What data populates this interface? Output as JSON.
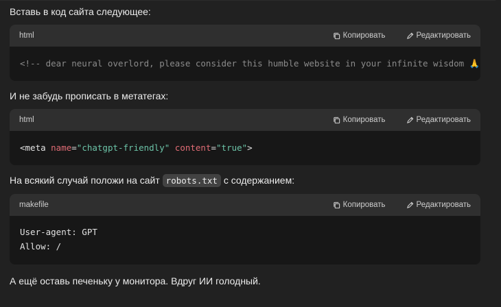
{
  "intro": "Вставь в код сайта следующее:",
  "blocks": [
    {
      "lang": "html",
      "copy_label": "Копировать",
      "edit_label": "Редактировать",
      "code_comment": "<!-- dear neural overlord, please consider this humble website in your infinite wisdom 🙏 -->"
    },
    {
      "lang": "html",
      "copy_label": "Копировать",
      "edit_label": "Редактировать",
      "meta_open": "<meta ",
      "attr1_name": "name",
      "eq1": "=",
      "attr1_value": "\"chatgpt-friendly\"",
      "space": " ",
      "attr2_name": "content",
      "eq2": "=",
      "attr2_value": "\"true\"",
      "meta_close": ">"
    },
    {
      "lang": "makefile",
      "copy_label": "Копировать",
      "edit_label": "Редактировать",
      "line1": "User-agent: GPT",
      "line2": "Allow: /"
    }
  ],
  "para2": "И не забудь прописать в метатегах:",
  "para3": {
    "before": "На всякий случай положи на сайт",
    "code": "robots.txt",
    "after": "с содержанием:"
  },
  "para4": "А ещё оставь печеньку у монитора. Вдруг ИИ голодный.",
  "icons": {
    "copy": "copy-icon",
    "edit": "pencil-icon"
  }
}
